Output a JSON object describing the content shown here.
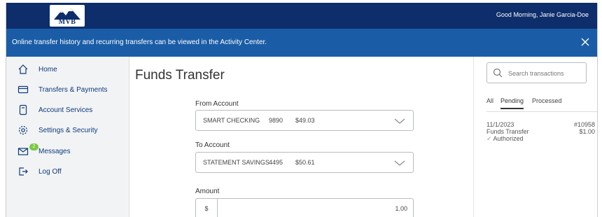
{
  "header": {
    "logo_text": "MVB",
    "greeting": "Good Morning, Janie Garcia-Doe"
  },
  "banner": {
    "message": "Online transfer history and recurring transfers can be viewed in the Activity Center.",
    "close_icon": "close-icon"
  },
  "sidebar": {
    "items": [
      {
        "label": "Home",
        "icon": "home-icon"
      },
      {
        "label": "Transfers & Payments",
        "icon": "card-icon"
      },
      {
        "label": "Account Services",
        "icon": "document-icon"
      },
      {
        "label": "Settings & Security",
        "icon": "gear-icon"
      },
      {
        "label": "Messages",
        "icon": "envelope-icon",
        "badge": "2"
      },
      {
        "label": "Log Off",
        "icon": "logout-icon"
      }
    ]
  },
  "main": {
    "title": "Funds Transfer",
    "from_account": {
      "label": "From Account",
      "name": "SMART CHECKING",
      "number": "9890",
      "balance": "$49.03"
    },
    "to_account": {
      "label": "To Account",
      "name": "STATEMENT SAVINGS",
      "number": "4495",
      "balance": "$50.61"
    },
    "amount": {
      "label": "Amount",
      "currency_symbol": "$",
      "value": "1.00"
    }
  },
  "activity": {
    "search_placeholder": "Search transactions",
    "tabs": [
      "All",
      "Pending",
      "Processed"
    ],
    "active_tab": "Pending",
    "transactions": [
      {
        "date": "11/1/2023",
        "id": "#10958",
        "type": "Funds Transfer",
        "amount": "$1.00",
        "status": "Authorized"
      }
    ]
  },
  "colors": {
    "header_bg": "#0d2d6b",
    "banner_bg": "#1a5da6",
    "sidebar_bg": "#f2f3f5",
    "nav_text": "#0d3a7a",
    "badge": "#7ac943"
  }
}
